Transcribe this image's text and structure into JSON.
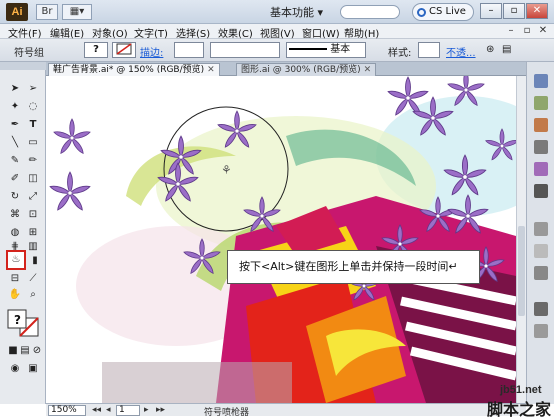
{
  "titlebar": {
    "logo": "Ai",
    "workspace": "基本功能",
    "workspace_chevron": "▾",
    "cslive": "CS Live",
    "minimize": "–",
    "restore": "▫",
    "close": "✕"
  },
  "menubar": {
    "items": [
      "文件(F)",
      "编辑(E)",
      "对象(O)",
      "文字(T)",
      "选择(S)",
      "效果(C)",
      "视图(V)",
      "窗口(W)",
      "帮助(H)"
    ],
    "controls": [
      "–",
      "▫",
      "✕"
    ]
  },
  "control_bar": {
    "tool_name": "符号组",
    "fill_label": "?",
    "stroke_label": "描边:",
    "stroke_value": "",
    "brush_profile": "",
    "brush_name": "基本",
    "style_label": "样式:",
    "opacity_link": "不透...",
    "icon": "globe-icon"
  },
  "tabs": [
    {
      "label": "鞋广告背景.ai* @ 150% (RGB/预览)",
      "active": true
    },
    {
      "label": "图形.ai @ 300% (RGB/预览)",
      "active": false
    }
  ],
  "tooltip": {
    "text": "按下<Alt>键在图形上单击并保持一段时间"
  },
  "status": {
    "zoom": "150%",
    "page": "1",
    "tool": "符号喷枪器"
  },
  "watermark": {
    "site": "jb51.net",
    "name": "脚本之家"
  },
  "colors": {
    "flower": "#9b6ec7",
    "flower_stroke": "#5f3a8a",
    "highlight": "#d3231c",
    "tooltip_border": "#555555"
  }
}
